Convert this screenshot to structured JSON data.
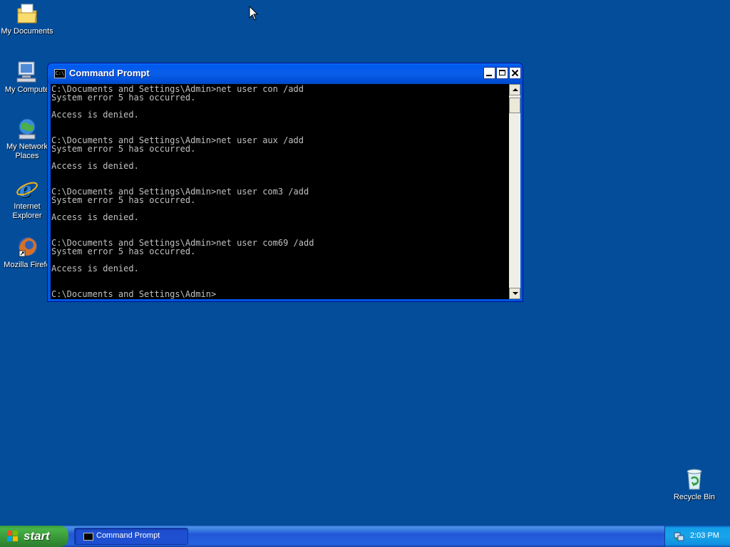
{
  "desktop": {
    "icons": [
      {
        "label": "My Documents",
        "icon": "my-documents-icon"
      },
      {
        "label": "My Compute",
        "icon": "my-computer-icon"
      },
      {
        "label": "My Network Places",
        "label_line1": "My Network",
        "label_line2": "Places",
        "icon": "my-network-places-icon"
      },
      {
        "label_line1": "Internet",
        "label_line2": "Explorer",
        "icon": "internet-explorer-icon"
      },
      {
        "label": "Mozilla Firefo",
        "icon": "firefox-icon"
      },
      {
        "label": "Recycle Bin",
        "icon": "recycle-bin-icon"
      }
    ]
  },
  "window": {
    "title": "Command Prompt",
    "app_icon_text": "C:\\",
    "console_lines": [
      "C:\\Documents and Settings\\Admin>net user con /add",
      "System error 5 has occurred.",
      "",
      "Access is denied.",
      "",
      "",
      "C:\\Documents and Settings\\Admin>net user aux /add",
      "System error 5 has occurred.",
      "",
      "Access is denied.",
      "",
      "",
      "C:\\Documents and Settings\\Admin>net user com3 /add",
      "System error 5 has occurred.",
      "",
      "Access is denied.",
      "",
      "",
      "C:\\Documents and Settings\\Admin>net user com69 /add",
      "System error 5 has occurred.",
      "",
      "Access is denied.",
      "",
      "",
      "C:\\Documents and Settings\\Admin>"
    ],
    "colors": {
      "title_bar": "#0058ee",
      "console_bg": "#000000",
      "console_text": "#c0c0c0"
    }
  },
  "taskbar": {
    "start_label": "start",
    "task_button_label": "Command Prompt",
    "clock": "2:03 PM",
    "colors": {
      "bar": "#2157d7",
      "start": "#3c9b3c",
      "tray": "#18a4ea"
    }
  }
}
